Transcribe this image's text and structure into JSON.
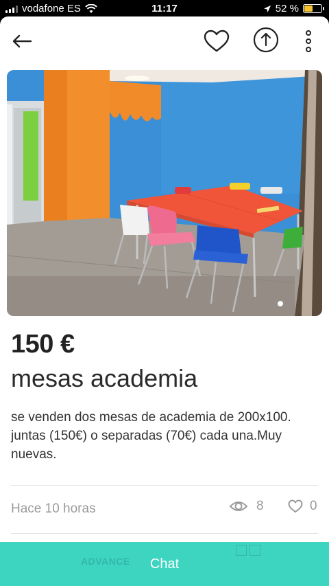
{
  "status_bar": {
    "carrier": "vodafone ES",
    "time": "11:17",
    "battery": "52 %",
    "battery_level": 0.52
  },
  "listing": {
    "price": "150 €",
    "title": "mesas academia",
    "description": "se venden dos mesas de academia de 200x100. juntas (150€) o separadas (70€) cada una.Muy nuevas.",
    "published": "Hace 10 horas",
    "views": "8",
    "likes": "0",
    "photo_count": 1,
    "current_photo": 1
  },
  "footer": {
    "chat_label": "Chat",
    "ad_text": "ADVANCE"
  },
  "icons": {
    "back": "arrow-left-icon",
    "favorite": "heart-icon",
    "share": "share-icon",
    "more": "more-vertical-icon",
    "views": "eye-icon",
    "likes": "heart-outline-icon"
  },
  "colors": {
    "accent": "#3dd5c0",
    "text_primary": "#222222",
    "text_muted": "#9b9b9b"
  }
}
